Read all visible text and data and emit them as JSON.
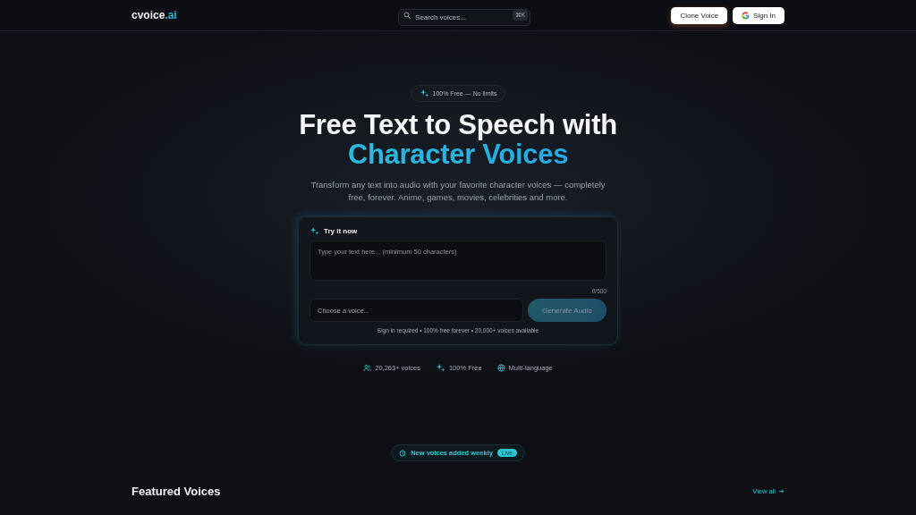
{
  "header": {
    "logo": {
      "name": "cvoice",
      "suffix": ".ai"
    },
    "search": {
      "placeholder": "Search voices...",
      "shortcut": "⌘K"
    },
    "buttons": [
      {
        "kind": "primary",
        "label": "Clone Voice"
      },
      {
        "kind": "google",
        "label": "Sign In"
      }
    ]
  },
  "hero": {
    "badge": "100% Free — No limits",
    "title_line1": "Free Text to Speech with",
    "title_line2": "Character Voices",
    "subtitle": "Transform any text into audio with your favorite character voices — completely free, forever. Anime, games, movies, celebrities and more."
  },
  "try_card": {
    "title": "Try it now",
    "text_placeholder": "Type your text here... (minimum 50 characters)",
    "counter": "0/500",
    "voice_placeholder": "Choose a voice...",
    "generate_button": {
      "label": "Generate Audio",
      "disabled": true
    },
    "note": "Sign in required • 100% free forever • 20,000+ voices available"
  },
  "stats": [
    {
      "kind": "users",
      "label": "20,263+ voices"
    },
    {
      "kind": "sparkle",
      "label": "100% Free"
    },
    {
      "kind": "globe",
      "label": "Multi-language"
    }
  ],
  "announcement": {
    "text": "New voices added weekly",
    "tag": "Live"
  },
  "featured": {
    "title": "Featured Voices",
    "link": "View all"
  }
}
